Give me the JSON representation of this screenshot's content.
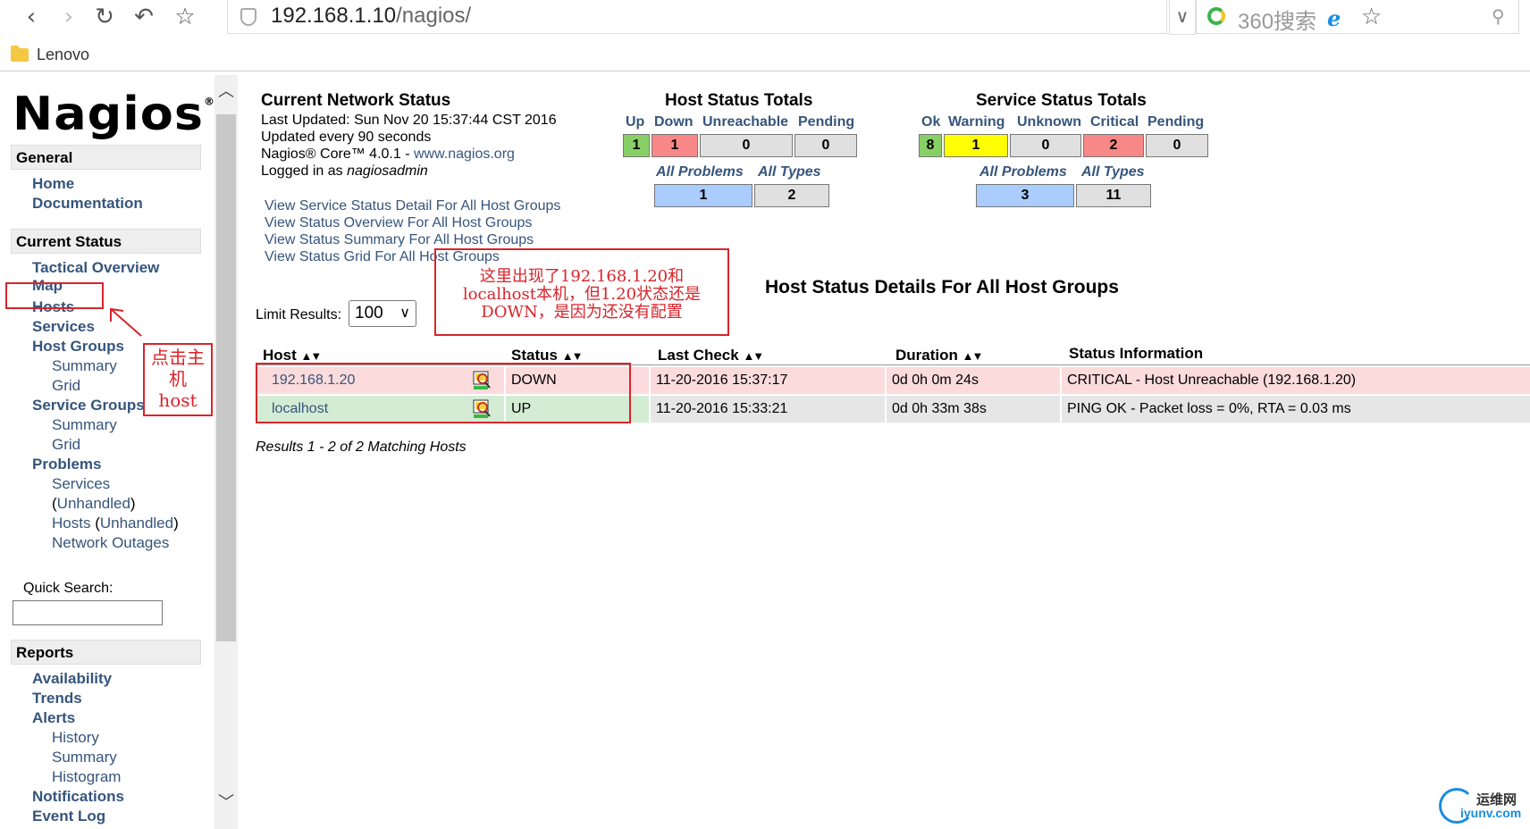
{
  "browser": {
    "url_host": "192.168.1.10",
    "url_path": "/nagios/",
    "search_placeholder": "360搜索",
    "bookmark_folder": "Lenovo"
  },
  "sidebar": {
    "logo": "Nagios",
    "logo_mark": "®",
    "general": {
      "header": "General",
      "items": [
        "Home",
        "Documentation"
      ]
    },
    "current_status": {
      "header": "Current Status",
      "tactical": "Tactical Overview",
      "map": "Map",
      "hosts": "Hosts",
      "services": "Services",
      "host_groups": "Host Groups",
      "hg_summary": "Summary",
      "hg_grid": "Grid",
      "service_groups": "Service Groups",
      "sg_summary": "Summary",
      "sg_grid": "Grid",
      "problems": "Problems",
      "p_services": "Services",
      "p_unhandled_a": "(",
      "p_unhandled_b": "Unhandled",
      "p_unhandled_c": ")",
      "p_hosts": "Hosts",
      "p_hosts_open": " (",
      "p_hosts_unhandled": "Unhandled",
      "p_hosts_close": ")",
      "network_outages": "Network Outages"
    },
    "quick_search_label": "Quick Search:",
    "reports": {
      "header": "Reports",
      "availability": "Availability",
      "trends": "Trends",
      "alerts": "Alerts",
      "history": "History",
      "summary": "Summary",
      "histogram": "Histogram",
      "notifications": "Notifications",
      "event_log": "Event Log"
    }
  },
  "status_info": {
    "title": "Current Network Status",
    "last_updated": "Last Updated: Sun Nov 20 15:37:44 CST 2016",
    "update_interval": "Updated every 90 seconds",
    "version_prefix": "Nagios® Core™ 4.0.1 - ",
    "version_link": "www.nagios.org",
    "logged_in_prefix": "Logged in as ",
    "user": "nagiosadmin",
    "links": [
      "View Service Status Detail For All Host Groups",
      "View Status Overview For All Host Groups",
      "View Status Summary For All Host Groups",
      "View Status Grid For All Host Groups"
    ]
  },
  "host_totals": {
    "title": "Host Status Totals",
    "labels": [
      "Up",
      "Down",
      "Unreachable",
      "Pending"
    ],
    "values": [
      "1",
      "1",
      "0",
      "0"
    ],
    "all_problems_label": "All Problems",
    "all_types_label": "All Types",
    "all_problems": "1",
    "all_types": "2"
  },
  "service_totals": {
    "title": "Service Status Totals",
    "labels": [
      "Ok",
      "Warning",
      "Unknown",
      "Critical",
      "Pending"
    ],
    "values": [
      "8",
      "1",
      "0",
      "2",
      "0"
    ],
    "all_problems_label": "All Problems",
    "all_types_label": "All Types",
    "all_problems": "3",
    "all_types": "11"
  },
  "colors": {
    "ok": "#88d066",
    "down": "#f88888",
    "warning": "#ffff00",
    "neutral": "#e0e0e0",
    "problems": "#aaccff",
    "row_down": "#fbdbdb",
    "row_up": "#d4ecd4",
    "row_grey": "#e6e6e6",
    "annotation": "#d9242b",
    "link": "#36557c"
  },
  "details": {
    "title": "Host Status Details For All Host Groups",
    "limit_label": "Limit Results:",
    "limit_value": "100",
    "columns": [
      "Host",
      "Status",
      "Last Check",
      "Duration",
      "Status Information"
    ],
    "rows": [
      {
        "host": "192.168.1.20",
        "status": "DOWN",
        "last_check": "11-20-2016 15:37:17",
        "duration": "0d 0h 0m 24s",
        "info": "CRITICAL - Host Unreachable (192.168.1.20)"
      },
      {
        "host": "localhost",
        "status": "UP",
        "last_check": "11-20-2016 15:33:21",
        "duration": "0d 0h 33m 38s",
        "info": "PING OK - Packet loss = 0%, RTA = 0.03 ms"
      }
    ],
    "results_text": "Results 1 - 2 of 2 Matching Hosts"
  },
  "annotations": {
    "note_lines": [
      "这里出现了192.168.1.20和",
      "localhost本机，但1.20状态还是",
      "DOWN，是因为还没有配置"
    ],
    "click_lines": [
      "点击主",
      "机",
      "host"
    ]
  },
  "watermark": {
    "line1": "运维网",
    "line2": "iyunv.com"
  }
}
